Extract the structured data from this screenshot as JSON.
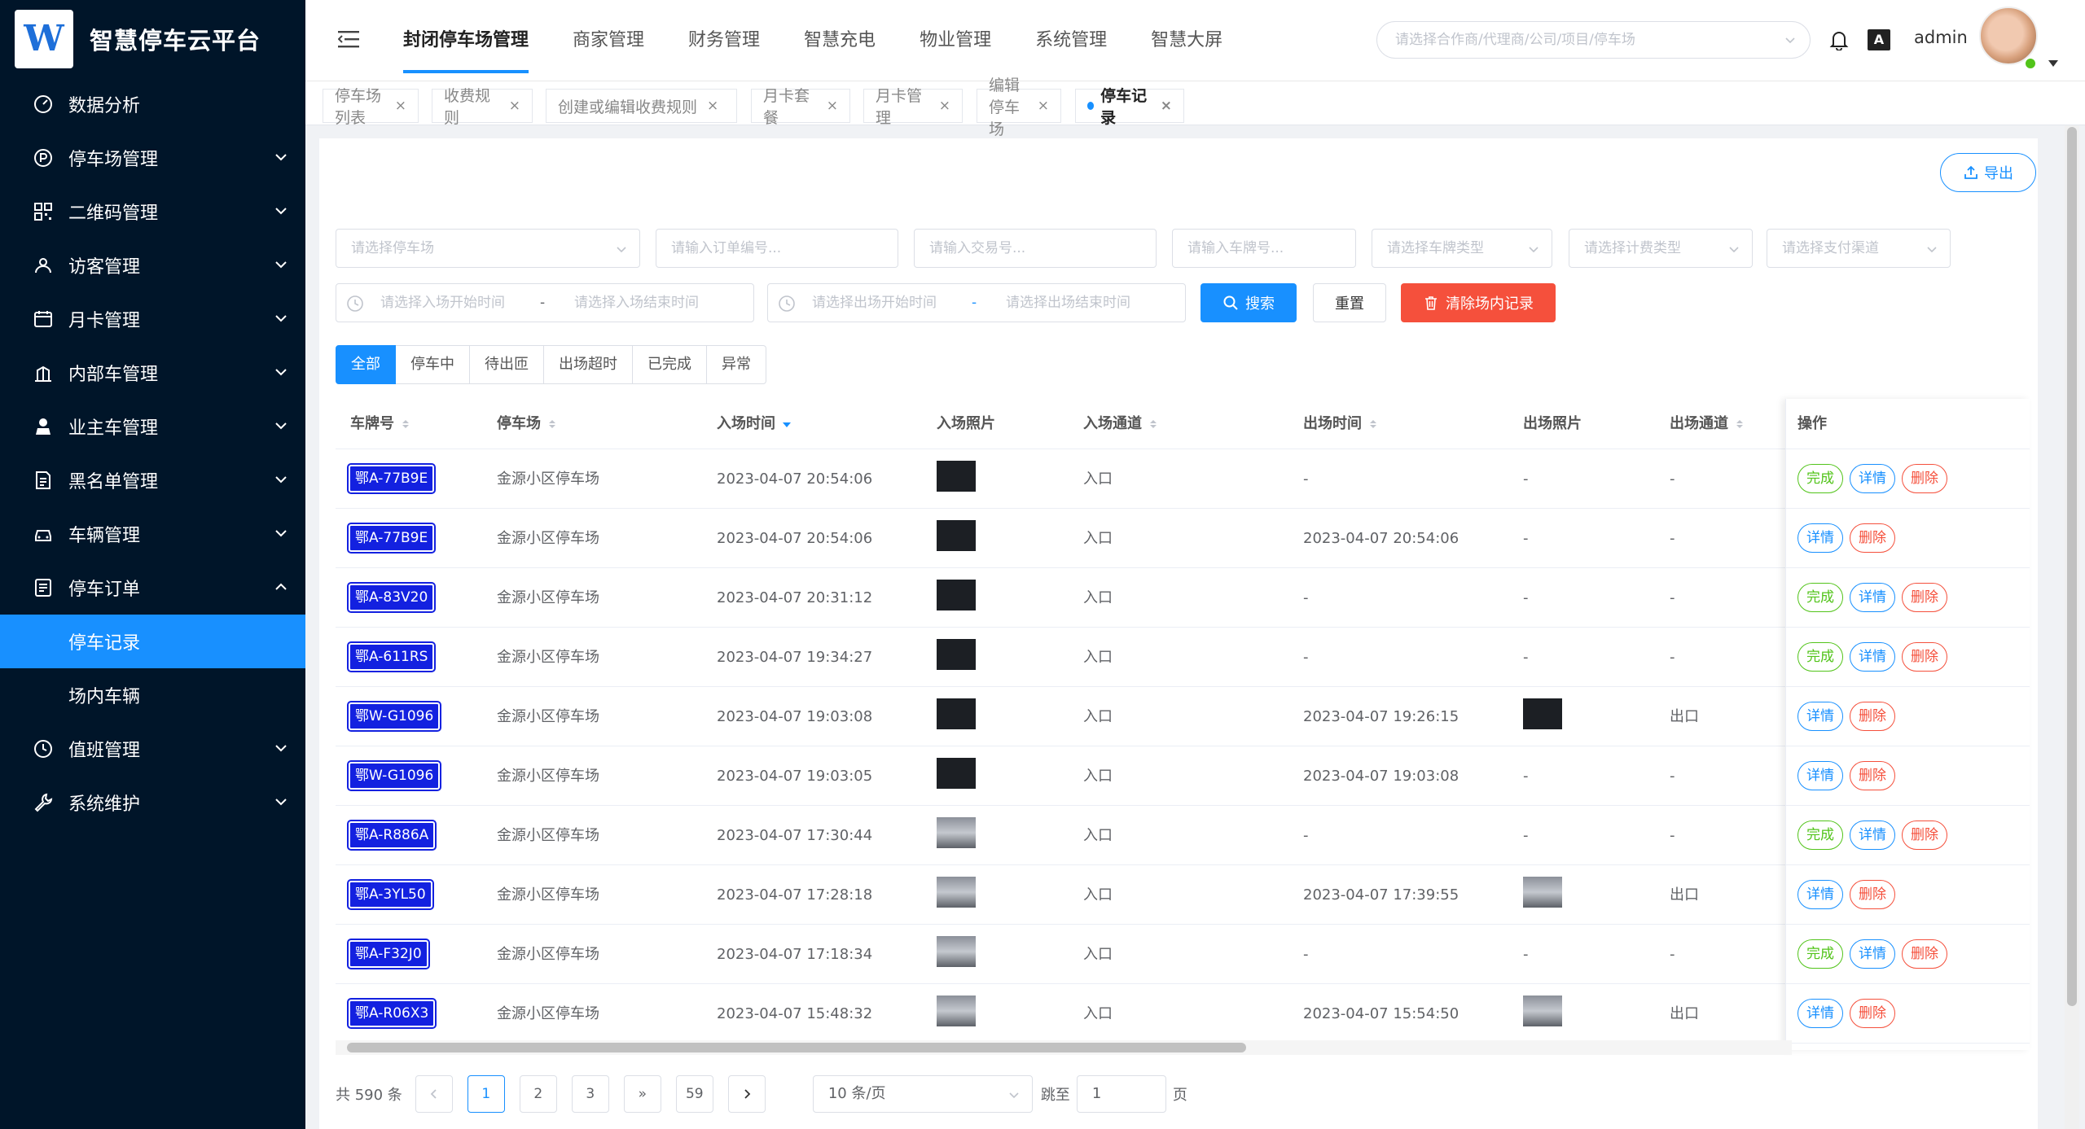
{
  "app": {
    "title": "智慧停车云平台",
    "logo_letter": "W"
  },
  "sidebar": {
    "items": [
      {
        "label": "数据分析",
        "icon": "gauge-icon",
        "arrow": ""
      },
      {
        "label": "停车场管理",
        "icon": "parking-icon",
        "arrow": "down"
      },
      {
        "label": "二维码管理",
        "icon": "qrcode-icon",
        "arrow": "down"
      },
      {
        "label": "访客管理",
        "icon": "visitor-icon",
        "arrow": "down"
      },
      {
        "label": "月卡管理",
        "icon": "card-icon",
        "arrow": "down"
      },
      {
        "label": "内部车管理",
        "icon": "building-icon",
        "arrow": "down"
      },
      {
        "label": "业主车管理",
        "icon": "user-icon",
        "arrow": "down"
      },
      {
        "label": "黑名单管理",
        "icon": "document-icon",
        "arrow": "down"
      },
      {
        "label": "车辆管理",
        "icon": "car-icon",
        "arrow": "down"
      },
      {
        "label": "停车订单",
        "icon": "order-icon",
        "arrow": "up"
      }
    ],
    "sub_items": [
      {
        "label": "停车记录",
        "active": true
      },
      {
        "label": "场内车辆",
        "active": false
      }
    ],
    "bottom_items": [
      {
        "label": "值班管理",
        "icon": "clock-icon",
        "arrow": "down"
      },
      {
        "label": "系统维护",
        "icon": "wrench-icon",
        "arrow": "down"
      }
    ]
  },
  "header": {
    "nav": [
      {
        "label": "封闭停车场管理",
        "active": true
      },
      {
        "label": "商家管理",
        "active": false
      },
      {
        "label": "财务管理",
        "active": false
      },
      {
        "label": "智慧充电",
        "active": false
      },
      {
        "label": "物业管理",
        "active": false
      },
      {
        "label": "系统管理",
        "active": false
      },
      {
        "label": "智慧大屏",
        "active": false
      }
    ],
    "select_placeholder": "请选择合作商/代理商/公司/项目/停车场",
    "translate_label": "A",
    "username": "admin"
  },
  "tabs": [
    {
      "label": "停车场列表",
      "active": false
    },
    {
      "label": "收费规则",
      "active": false
    },
    {
      "label": "创建或编辑收费规则",
      "active": false
    },
    {
      "label": "月卡套餐",
      "active": false
    },
    {
      "label": "月卡管理",
      "active": false
    },
    {
      "label": "编辑停车场",
      "active": false
    },
    {
      "label": "停车记录",
      "active": true
    }
  ],
  "toolbar": {
    "export_label": "导出"
  },
  "filters": {
    "parking_lot": "请选择停车场",
    "order_no": "请输入订单编号...",
    "trade_no": "请输入交易号...",
    "plate_no": "请输入车牌号...",
    "plate_type": "请选择车牌类型",
    "billing_type": "请选择计费类型",
    "pay_channel": "请选择支付渠道",
    "entry_start": "请选择入场开始时间",
    "entry_end": "请选择入场结束时间",
    "exit_start": "请选择出场开始时间",
    "exit_end": "请选择出场结束时间",
    "range_sep": "-",
    "search_label": "搜索",
    "reset_label": "重置",
    "clear_label": "清除场内记录"
  },
  "status_tabs": [
    {
      "label": "全部",
      "active": true
    },
    {
      "label": "停车中",
      "active": false
    },
    {
      "label": "待出匝",
      "active": false
    },
    {
      "label": "出场超时",
      "active": false
    },
    {
      "label": "已完成",
      "active": false
    },
    {
      "label": "异常",
      "active": false
    }
  ],
  "table": {
    "columns": [
      "车牌号",
      "停车场",
      "入场时间",
      "入场照片",
      "入场通道",
      "出场时间",
      "出场照片",
      "出场通道",
      "操作"
    ],
    "rows": [
      {
        "plate": "鄂A-77B9E",
        "lot": "金源小区停车场",
        "entry_time": "2023-04-07 20:54:06",
        "entry_photo": "dark",
        "entry_lane": "入口",
        "exit_time": "-",
        "exit_photo": "-",
        "exit_lane": "-",
        "actions": [
          "完成",
          "详情",
          "删除"
        ]
      },
      {
        "plate": "鄂A-77B9E",
        "lot": "金源小区停车场",
        "entry_time": "2023-04-07 20:54:06",
        "entry_photo": "dark",
        "entry_lane": "入口",
        "exit_time": "2023-04-07 20:54:06",
        "exit_photo": "-",
        "exit_lane": "-",
        "actions": [
          "详情",
          "删除"
        ]
      },
      {
        "plate": "鄂A-83V20",
        "lot": "金源小区停车场",
        "entry_time": "2023-04-07 20:31:12",
        "entry_photo": "dark",
        "entry_lane": "入口",
        "exit_time": "-",
        "exit_photo": "-",
        "exit_lane": "-",
        "actions": [
          "完成",
          "详情",
          "删除"
        ]
      },
      {
        "plate": "鄂A-611RS",
        "lot": "金源小区停车场",
        "entry_time": "2023-04-07 19:34:27",
        "entry_photo": "dark",
        "entry_lane": "入口",
        "exit_time": "-",
        "exit_photo": "-",
        "exit_lane": "-",
        "actions": [
          "完成",
          "详情",
          "删除"
        ]
      },
      {
        "plate": "鄂W-G1096",
        "lot": "金源小区停车场",
        "entry_time": "2023-04-07 19:03:08",
        "entry_photo": "dark",
        "entry_lane": "入口",
        "exit_time": "2023-04-07 19:26:15",
        "exit_photo": "dark",
        "exit_lane": "出口",
        "actions": [
          "详情",
          "删除"
        ]
      },
      {
        "plate": "鄂W-G1096",
        "lot": "金源小区停车场",
        "entry_time": "2023-04-07 19:03:05",
        "entry_photo": "dark",
        "entry_lane": "入口",
        "exit_time": "2023-04-07 19:03:08",
        "exit_photo": "-",
        "exit_lane": "-",
        "actions": [
          "详情",
          "删除"
        ]
      },
      {
        "plate": "鄂A-R886A",
        "lot": "金源小区停车场",
        "entry_time": "2023-04-07 17:30:44",
        "entry_photo": "light",
        "entry_lane": "入口",
        "exit_time": "-",
        "exit_photo": "-",
        "exit_lane": "-",
        "actions": [
          "完成",
          "详情",
          "删除"
        ]
      },
      {
        "plate": "鄂A-3YL50",
        "lot": "金源小区停车场",
        "entry_time": "2023-04-07 17:28:18",
        "entry_photo": "light",
        "entry_lane": "入口",
        "exit_time": "2023-04-07 17:39:55",
        "exit_photo": "light",
        "exit_lane": "出口",
        "actions": [
          "详情",
          "删除"
        ]
      },
      {
        "plate": "鄂A-F32J0",
        "lot": "金源小区停车场",
        "entry_time": "2023-04-07 17:18:34",
        "entry_photo": "light",
        "entry_lane": "入口",
        "exit_time": "-",
        "exit_photo": "-",
        "exit_lane": "-",
        "actions": [
          "完成",
          "详情",
          "删除"
        ]
      },
      {
        "plate": "鄂A-R06X3",
        "lot": "金源小区停车场",
        "entry_time": "2023-04-07 15:48:32",
        "entry_photo": "light",
        "entry_lane": "入口",
        "exit_time": "2023-04-07 15:54:50",
        "exit_photo": "light",
        "exit_lane": "出口",
        "actions": [
          "详情",
          "删除"
        ]
      }
    ]
  },
  "pagination": {
    "total_label": "共 590 条",
    "pages": [
      "1",
      "2",
      "3"
    ],
    "jump_more": "»",
    "last_page": "59",
    "current": "1",
    "page_size": "10 条/页",
    "goto_label": "跳至",
    "goto_value": "1",
    "page_suffix": "页"
  },
  "colors": {
    "sidebar_bg": "#001529",
    "accent": "#1890ff",
    "danger": "#f5503c",
    "success": "#52c41a",
    "plate_blue": "#1321e0"
  }
}
